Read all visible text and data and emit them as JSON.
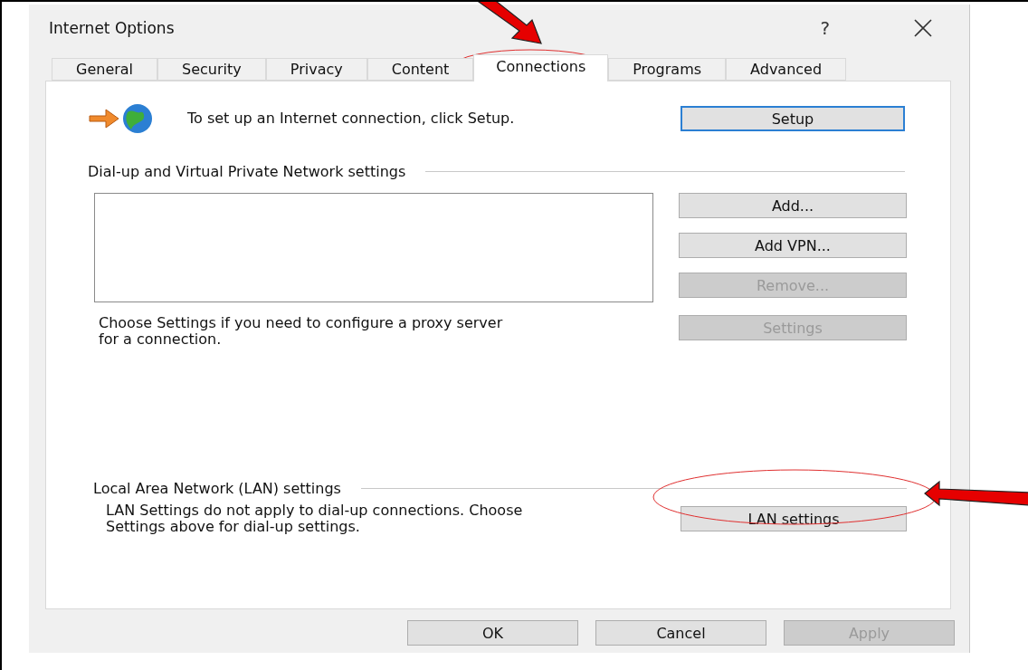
{
  "window": {
    "title": "Internet Options",
    "help": "?"
  },
  "tabs": [
    {
      "label": "General",
      "selected": false
    },
    {
      "label": "Security",
      "selected": false
    },
    {
      "label": "Privacy",
      "selected": false
    },
    {
      "label": "Content",
      "selected": false
    },
    {
      "label": "Connections",
      "selected": true
    },
    {
      "label": "Programs",
      "selected": false
    },
    {
      "label": "Advanced",
      "selected": false
    }
  ],
  "setup": {
    "text": "To set up an Internet connection, click Setup.",
    "button": "Setup"
  },
  "dialup": {
    "heading": "Dial-up and Virtual Private Network settings",
    "buttons": [
      {
        "label": "Add...",
        "disabled": false
      },
      {
        "label": "Add VPN...",
        "disabled": false
      },
      {
        "label": "Remove...",
        "disabled": true
      },
      {
        "label": "Settings",
        "disabled": true
      }
    ],
    "note": "Choose Settings if you need to configure a proxy server for a connection."
  },
  "lan": {
    "heading": "Local Area Network (LAN) settings",
    "note": "LAN Settings do not apply to dial-up connections. Choose Settings above for dial-up settings.",
    "button": "LAN settings"
  },
  "footer_buttons": [
    {
      "label": "OK",
      "disabled": false
    },
    {
      "label": "Cancel",
      "disabled": false
    },
    {
      "label": "Apply",
      "disabled": true
    }
  ]
}
